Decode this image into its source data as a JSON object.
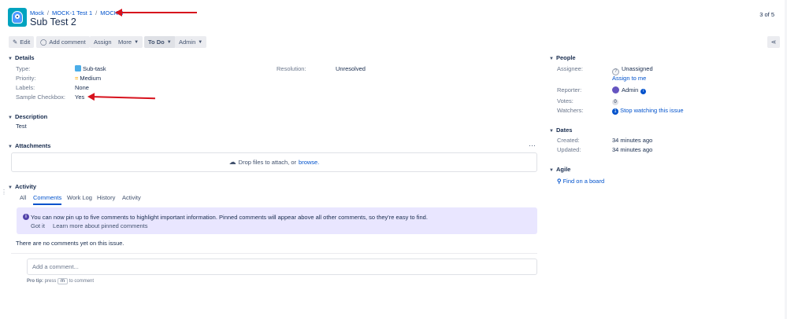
{
  "header": {
    "breadcrumbs": [
      "Mock",
      "MOCK-1 Test 1",
      "MOCK-3"
    ],
    "title": "Sub Test 2",
    "pager": "3 of 5"
  },
  "toolbar": {
    "edit": "Edit",
    "add_comment": "Add comment",
    "assign": "Assign",
    "more": "More",
    "status": "To Do",
    "admin": "Admin"
  },
  "details": {
    "heading": "Details",
    "type_label": "Type:",
    "type_value": "Sub-task",
    "priority_label": "Priority:",
    "priority_value": "Medium",
    "labels_label": "Labels:",
    "labels_value": "None",
    "checkbox_label": "Sample Checkbox:",
    "checkbox_value": "Yes",
    "resolution_label": "Resolution:",
    "resolution_value": "Unresolved"
  },
  "description": {
    "heading": "Description",
    "text": "Test"
  },
  "attachments": {
    "heading": "Attachments",
    "drop_text": "Drop files to attach, or",
    "browse": "browse."
  },
  "activity": {
    "heading": "Activity",
    "tabs": [
      "All",
      "Comments",
      "Work Log",
      "History",
      "Activity"
    ],
    "active_tab": "Comments",
    "notice_text": "You can now pin up to five comments to highlight important information. Pinned comments will appear above all other comments, so they're easy to find.",
    "notice_got_it": "Got it",
    "notice_learn_more": "Learn more about pinned comments",
    "no_comments": "There are no comments yet on this issue.",
    "comment_placeholder": "Add a comment...",
    "protip_label": "Pro tip:",
    "protip_press": "press",
    "protip_key": "m",
    "protip_suffix": "to comment"
  },
  "people": {
    "heading": "People",
    "assignee_label": "Assignee:",
    "assignee_value": "Unassigned",
    "assign_to_me": "Assign to me",
    "reporter_label": "Reporter:",
    "reporter_value": "Admin",
    "votes_label": "Votes:",
    "votes_value": "0",
    "watchers_label": "Watchers:",
    "watchers_value": "1",
    "stop_watching": "Stop watching this issue"
  },
  "dates": {
    "heading": "Dates",
    "created_label": "Created:",
    "created_value": "34 minutes ago",
    "updated_label": "Updated:",
    "updated_value": "34 minutes ago"
  },
  "agile": {
    "heading": "Agile",
    "find_board": "Find on a board"
  },
  "colors": {
    "link": "#0052cc",
    "annotation_arrow": "#d7121d",
    "notice_bg": "#e9e6ff",
    "subtask_icon": "#4bade8",
    "priority_icon": "#ffab00"
  }
}
